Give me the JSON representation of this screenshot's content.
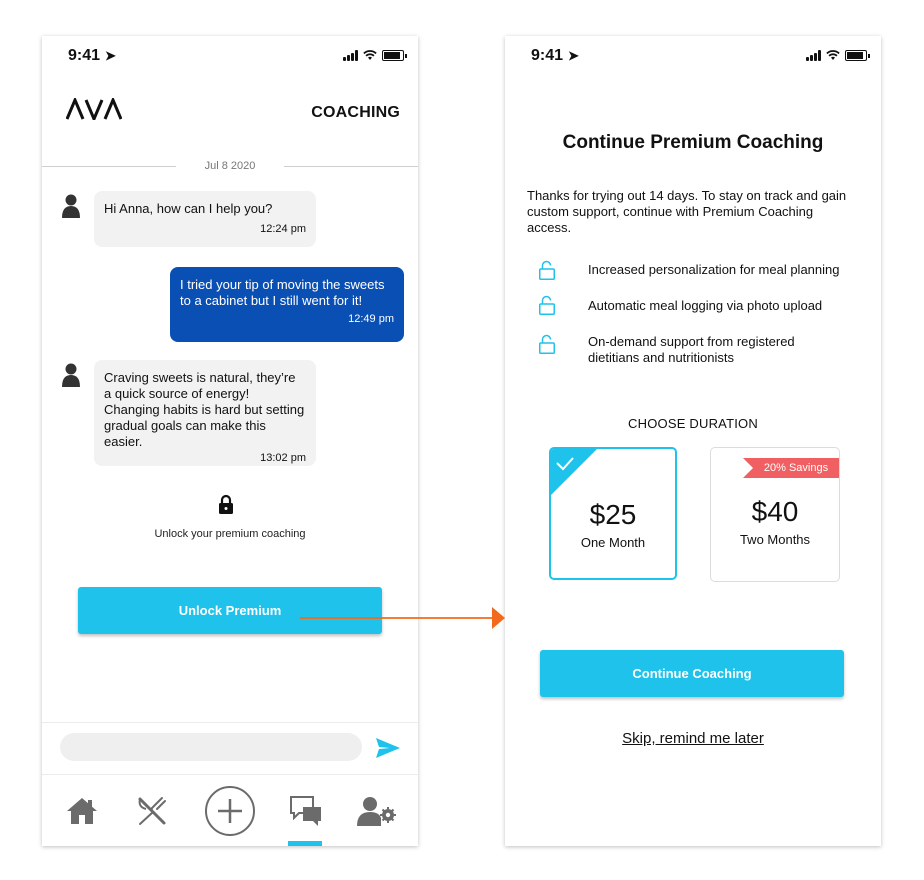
{
  "left_screen": {
    "status": {
      "time": "9:41"
    },
    "header": {
      "logo": "AVA",
      "title": "COACHING"
    },
    "date_divider": "Jul 8 2020",
    "messages": [
      {
        "from": "coach",
        "text": "Hi Anna, how can I help you?",
        "time": "12:24 pm"
      },
      {
        "from": "user",
        "text": "I tried your tip of moving the sweets to a cabinet but I still went for it!",
        "time": "12:49 pm"
      },
      {
        "from": "coach",
        "text": "Craving sweets is natural, they’re a quick source of energy! Changing habits is hard but setting gradual goals can make this easier.",
        "time": "13:02 pm"
      }
    ],
    "lock_message": "Unlock your premium coaching",
    "unlock_button": "Unlock Premium",
    "compose": {
      "placeholder": "",
      "send_icon": "send-icon"
    },
    "tabs": [
      {
        "name": "home",
        "icon": "home-icon"
      },
      {
        "name": "meals",
        "icon": "fork-knife-icon"
      },
      {
        "name": "add",
        "icon": "plus-circle-icon"
      },
      {
        "name": "coaching",
        "icon": "chat-icon",
        "active": true
      },
      {
        "name": "profile",
        "icon": "user-settings-icon"
      }
    ]
  },
  "right_screen": {
    "status": {
      "time": "9:41"
    },
    "title": "Continue Premium Coaching",
    "intro": "Thanks for trying out 14 days. To stay on track and gain custom support, continue with Premium Coaching access.",
    "features": [
      "Increased personalization for meal planning",
      "Automatic meal logging via photo upload",
      "On-demand support from registered dietitians and nutritionists"
    ],
    "choose_label": "CHOOSE DURATION",
    "plans": [
      {
        "price": "$25",
        "period": "One Month",
        "selected": true
      },
      {
        "price": "$40",
        "period": "Two Months",
        "badge": "20% Savings",
        "selected": false
      }
    ],
    "continue_button": "Continue Coaching",
    "skip_link": "Skip, remind me later"
  },
  "colors": {
    "accent": "#1ec2ea",
    "user_bubble": "#0a4fb3",
    "badge": "#f06062",
    "flow_arrow": "#f26a1b"
  }
}
